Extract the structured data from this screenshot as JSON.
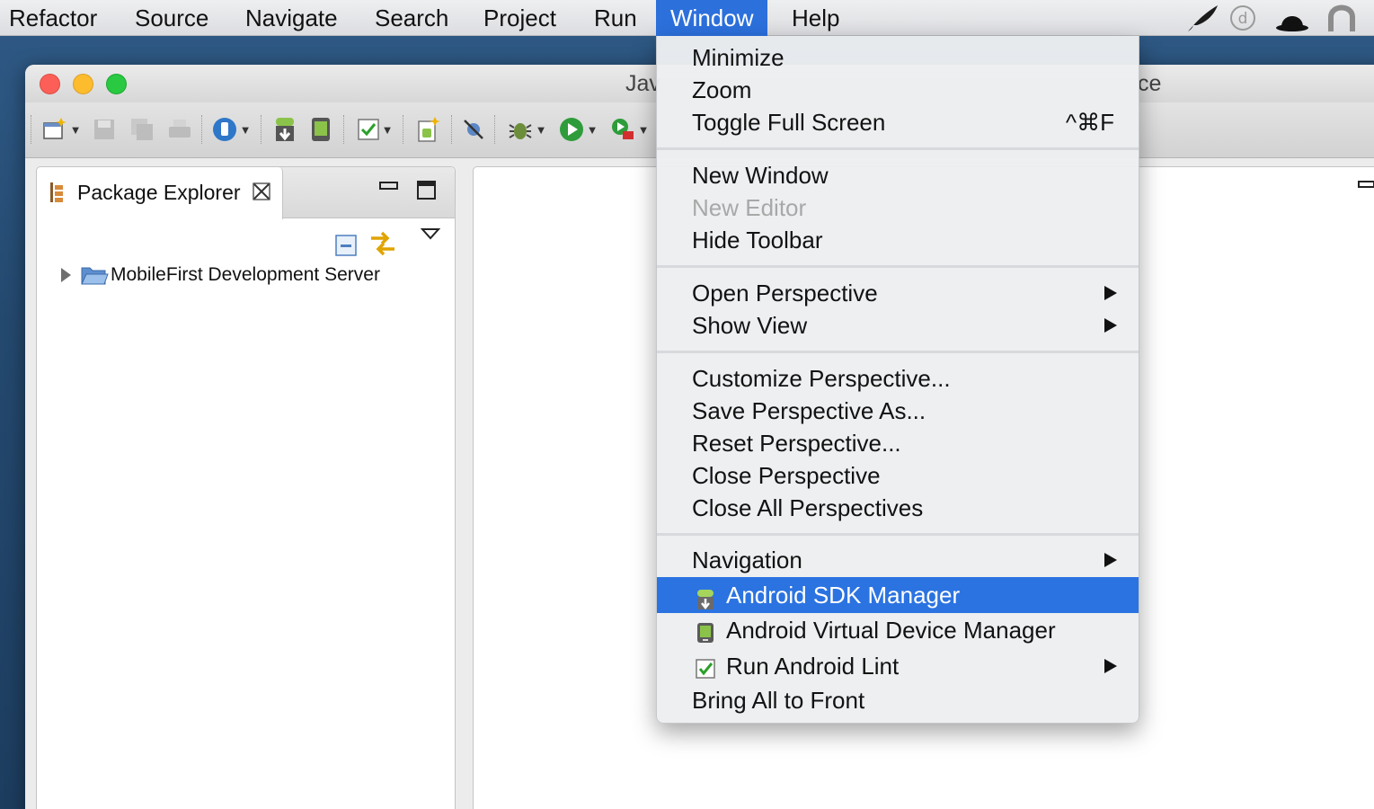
{
  "menubar": {
    "items": [
      "Refactor",
      "Source",
      "Navigate",
      "Search",
      "Project",
      "Run",
      "Window",
      "Help"
    ],
    "active": "Window",
    "tray_icons": [
      "feather-icon",
      "dash-icon",
      "bowler-hat-icon",
      "horseshoe-icon"
    ]
  },
  "window": {
    "title_left": "Jav",
    "title_right": "ce",
    "traffic_lights": {
      "close": "#fc5f57",
      "minimize": "#fdbc2e",
      "zoom": "#29c941"
    }
  },
  "package_explorer": {
    "tab_label": "Package Explorer",
    "tree": [
      {
        "label": "MobileFirst Development Server",
        "expanded": false
      }
    ]
  },
  "window_menu": {
    "groups": [
      [
        {
          "label": "Minimize"
        },
        {
          "label": "Zoom"
        },
        {
          "label": "Toggle Full Screen",
          "shortcut": "^⌘F"
        }
      ],
      [
        {
          "label": "New Window"
        },
        {
          "label": "New Editor",
          "disabled": true
        },
        {
          "label": "Hide Toolbar"
        }
      ],
      [
        {
          "label": "Open Perspective",
          "submenu": true
        },
        {
          "label": "Show View",
          "submenu": true
        }
      ],
      [
        {
          "label": "Customize Perspective..."
        },
        {
          "label": "Save Perspective As..."
        },
        {
          "label": "Reset Perspective..."
        },
        {
          "label": "Close Perspective"
        },
        {
          "label": "Close All Perspectives"
        }
      ],
      [
        {
          "label": "Navigation",
          "submenu": true
        },
        {
          "label": "Android SDK Manager",
          "icon": "android-sdk-manager-icon",
          "highlighted": true
        },
        {
          "label": "Android Virtual Device Manager",
          "icon": "android-avd-manager-icon"
        },
        {
          "label": "Run Android Lint",
          "icon": "lint-check-icon",
          "submenu": true
        },
        {
          "label": "Bring All to Front"
        }
      ]
    ]
  },
  "colors": {
    "menu_highlight": "#2b73e1",
    "menubar_active": "#2c70dc",
    "desktop": "#24496f"
  }
}
